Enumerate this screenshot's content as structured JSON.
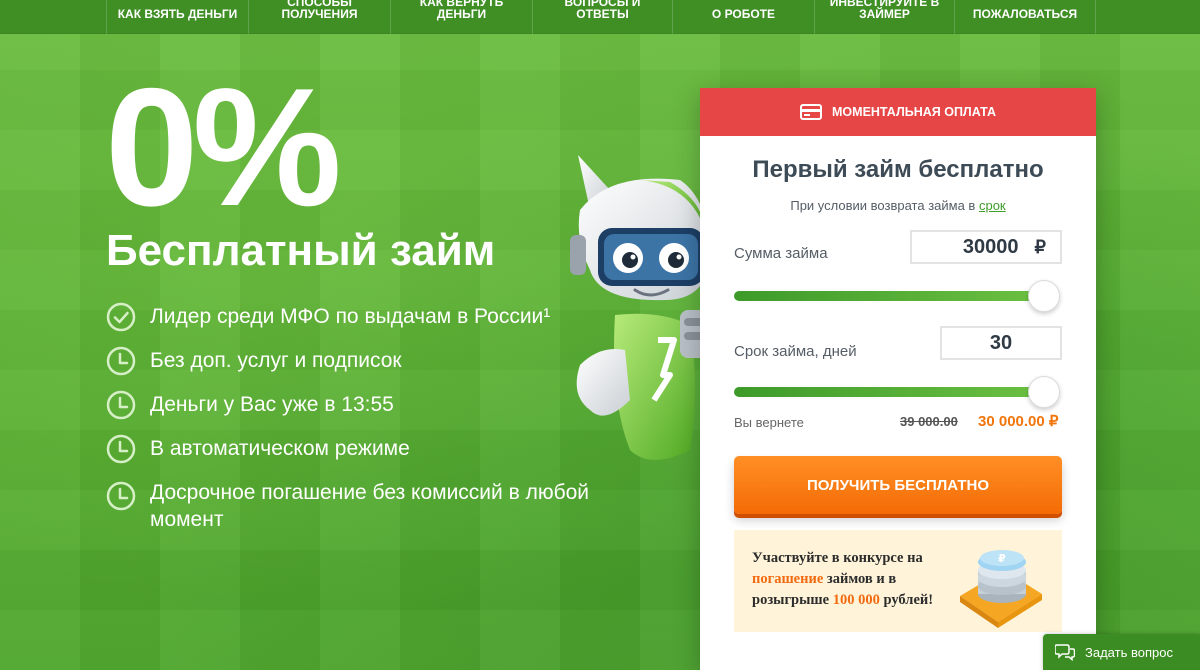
{
  "nav": {
    "items": [
      {
        "label": "КАК ВЗЯТЬ ДЕНЬГИ"
      },
      {
        "label": "СПОСОБЫ ПОЛУЧЕНИЯ"
      },
      {
        "label": "КАК ВЕРНУТЬ ДЕНЬГИ"
      },
      {
        "label": "ВОПРОСЫ И ОТВЕТЫ"
      },
      {
        "label": "О РОБОТЕ"
      },
      {
        "label": "ИНВЕСТИРУЙТЕ В ЗАЙМЕР"
      },
      {
        "label": "ПОЖАЛОВАТЬСЯ"
      }
    ]
  },
  "hero": {
    "percent": "0%",
    "title": "Бесплатный займ",
    "features": [
      {
        "text": "Лидер среди МФО по выдачам в России¹",
        "icon": "check-circle-icon"
      },
      {
        "text": "Без доп. услуг и подписок",
        "icon": "clock-icon"
      },
      {
        "text": "Деньги у Вас уже в 13:55",
        "icon": "clock-icon"
      },
      {
        "text": "В автоматическом режиме",
        "icon": "clock-icon"
      },
      {
        "text": "Досрочное погашение без комиссий в любой момент",
        "icon": "clock-icon"
      }
    ]
  },
  "card": {
    "header": "МОМЕНТАЛЬНАЯ ОПЛАТА",
    "title": "Первый займ бесплатно",
    "subtitle_prefix": "При условии возврата займа в",
    "subtitle_link": "срок",
    "amount_label": "Сумма займа",
    "amount_value": "30000",
    "currency": "₽",
    "amount_level": 1.0,
    "term_label": "Срок займа, дней",
    "term_value": "30",
    "term_level": 1.0,
    "return_label": "Вы вернете",
    "return_old": "39 000.00",
    "return_new": "30 000.00 ₽",
    "cta_label": "ПОЛУЧИТЬ БЕСПЛАТНО",
    "promo": {
      "line1": "Участвуйте в конкурсе на",
      "highlight1": "погашение",
      "line2": " займов и в",
      "line3": "розыгрыше ",
      "highlight2": "100 000",
      "line4": " рублей!"
    }
  },
  "ask": {
    "label": "Задать вопрос"
  },
  "colors": {
    "brand_green": "#5fb336",
    "nav_green": "#3f8f25",
    "header_red": "#e64646",
    "cta_orange": "#f46b05",
    "promo_bg": "#fff4d9"
  }
}
